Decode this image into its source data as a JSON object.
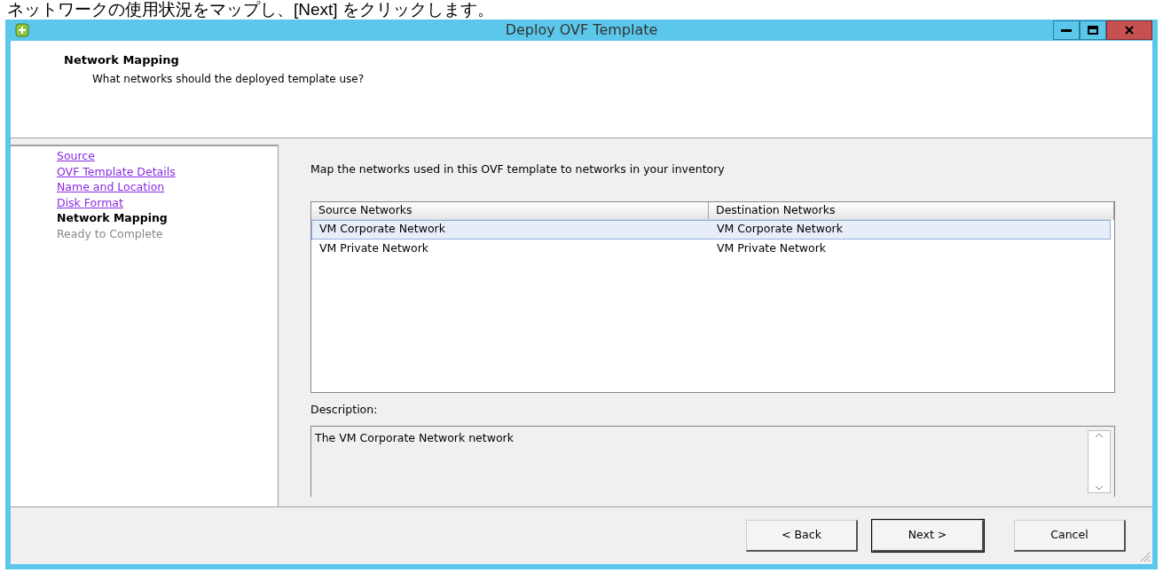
{
  "caption": "ネットワークの使用状況をマップし、[Next] をクリックします。",
  "window": {
    "title": "Deploy OVF Template"
  },
  "header": {
    "title": "Network Mapping",
    "subtitle": "What networks should the deployed template use?"
  },
  "steps": [
    {
      "label": "Source",
      "kind": "done",
      "selected": false
    },
    {
      "label": "OVF Template Details",
      "kind": "done",
      "selected": false
    },
    {
      "label": "Name and Location",
      "kind": "done",
      "selected": false
    },
    {
      "label": "Disk Format",
      "kind": "done",
      "selected": false
    },
    {
      "label": "Network Mapping",
      "kind": "current",
      "selected": true
    },
    {
      "label": "Ready to Complete",
      "kind": "pending",
      "selected": false
    }
  ],
  "instruction": "Map the networks used in this OVF template to networks in your inventory",
  "table": {
    "columns": [
      "Source Networks",
      "Destination Networks"
    ],
    "rows": [
      {
        "cells": [
          "VM Corporate Network",
          "VM Corporate Network"
        ],
        "selected": true
      },
      {
        "cells": [
          "VM Private Network",
          "VM Private Network"
        ],
        "selected": false
      }
    ]
  },
  "description": {
    "label": "Description:",
    "value": "The VM Corporate Network network"
  },
  "buttons": [
    "< Back",
    "Next >",
    "Cancel"
  ]
}
